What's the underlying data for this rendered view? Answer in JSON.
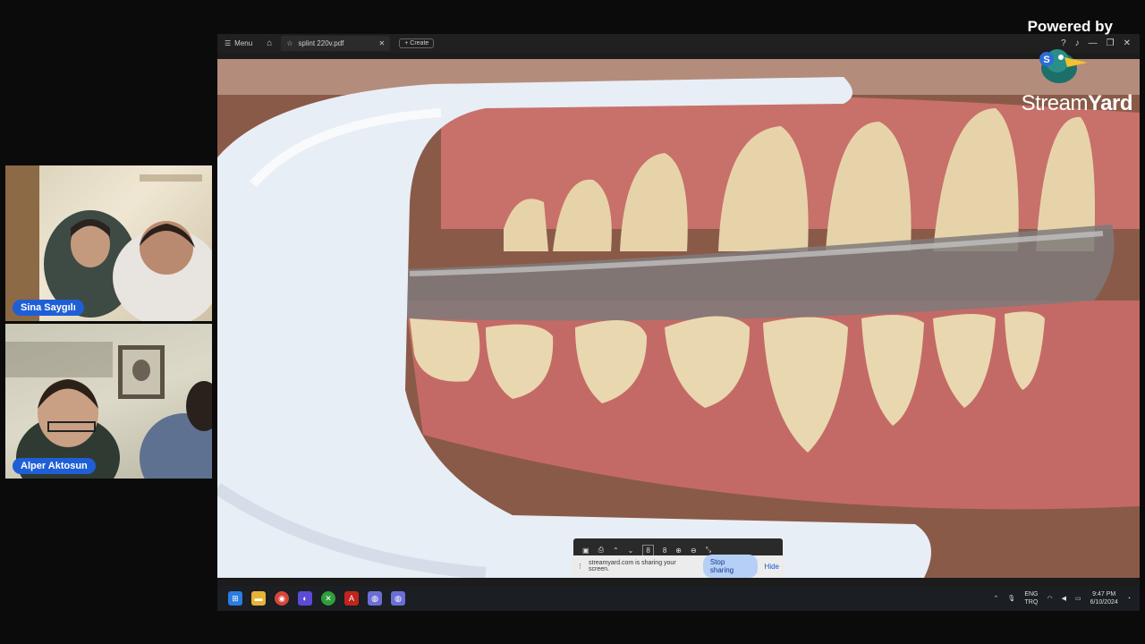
{
  "participants": [
    {
      "name": "Sina Saygılı"
    },
    {
      "name": "Alper Aktosun"
    }
  ],
  "window": {
    "menu_label": "Menu",
    "tab_label": "splint 220v.pdf",
    "create_label": "Create"
  },
  "pdf_toolbar": {
    "page_current": "8",
    "page_total": "8"
  },
  "share_notice": {
    "text": "streamyard.com is sharing your screen.",
    "stop_label": "Stop sharing",
    "hide_label": "Hide"
  },
  "taskbar": {
    "lang_top": "ENG",
    "lang_bottom": "TRQ",
    "time": "9:47 PM",
    "date": "6/10/2024"
  },
  "branding": {
    "powered_by": "Powered by",
    "name_light": "Stream",
    "name_bold": "Yard"
  },
  "colors": {
    "name_tag": "#1f5fd6",
    "stop_button": "#b6cff7"
  }
}
